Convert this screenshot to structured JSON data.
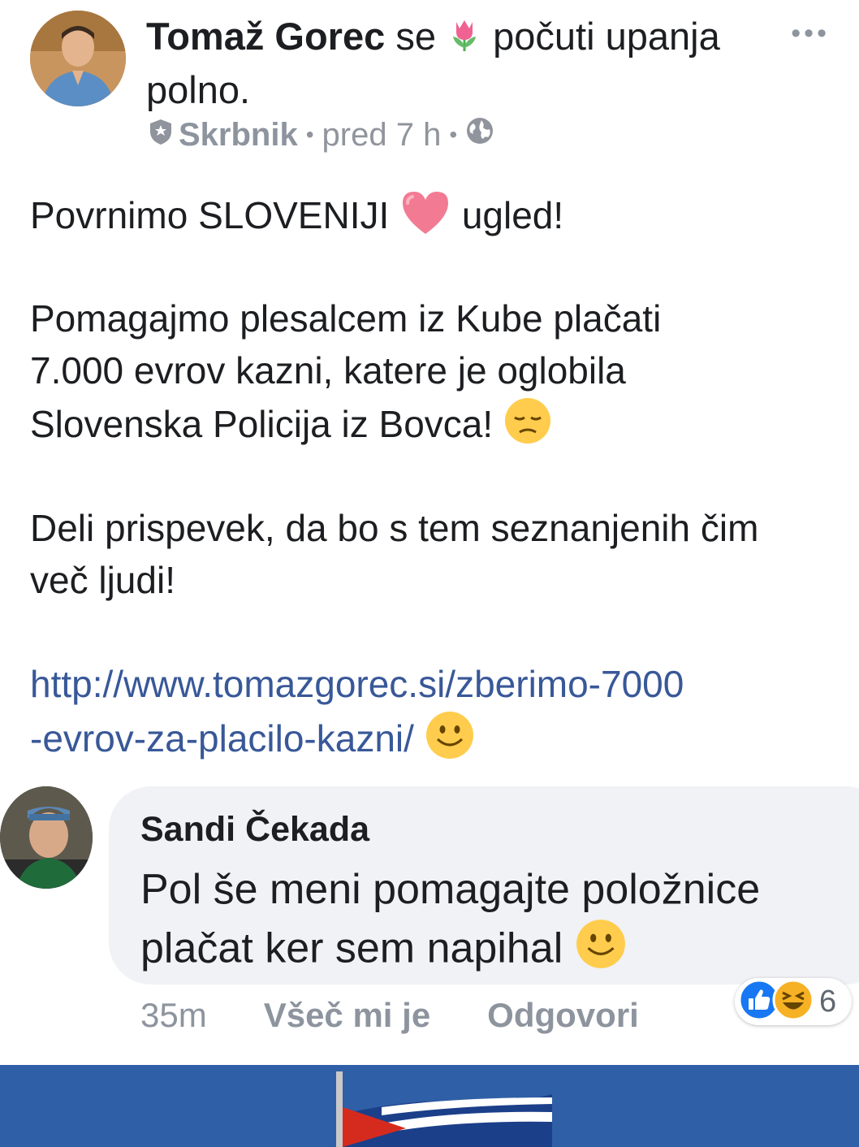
{
  "post": {
    "author": "Tomaž Gorec",
    "action_prefix": "se",
    "feeling_icon": "tulip-emoji",
    "action_suffix": "počuti upanja polno.",
    "role": "Skrbnik",
    "time": "pred 7 h",
    "privacy_icon": "globe-icon",
    "more_label": "•••",
    "paragraphs": {
      "p1_a": "Povrnimo SLOVENIJI",
      "p1_b": "ugled!",
      "p2_line1": "Pomagajmo plesalcem iz Kube plačati",
      "p2_line2": "7.000 evrov kazni, katere je oglobila",
      "p2_line3": "Slovenska Policija iz Bovca!",
      "p3_line1": "Deli prispevek, da bo s tem seznanjenih čim",
      "p3_line2": "več ljudi!",
      "link_line1": "http://www.tomazgorec.si/zberimo-7000",
      "link_line2": "-evrov-za-placilo-kazni/"
    },
    "emojis": [
      "heart-emoji",
      "pensive-face-emoji",
      "smiling-face-emoji"
    ]
  },
  "comment": {
    "author": "Sandi Čekada",
    "text_line1": "Pol še meni pomagajte položnice",
    "text_line2": "plačat ker sem  napihal",
    "time": "35m",
    "like_label": "Všeč mi je",
    "reply_label": "Odgovori",
    "reaction_icons": [
      "like-reaction-icon",
      "haha-reaction-icon"
    ],
    "reaction_count": "6"
  },
  "colors": {
    "link": "#385898",
    "meta": "#90949c",
    "bubble": "#f0f2f5",
    "like_blue": "#1877f2",
    "flag_blue": "#2f5fa6"
  }
}
